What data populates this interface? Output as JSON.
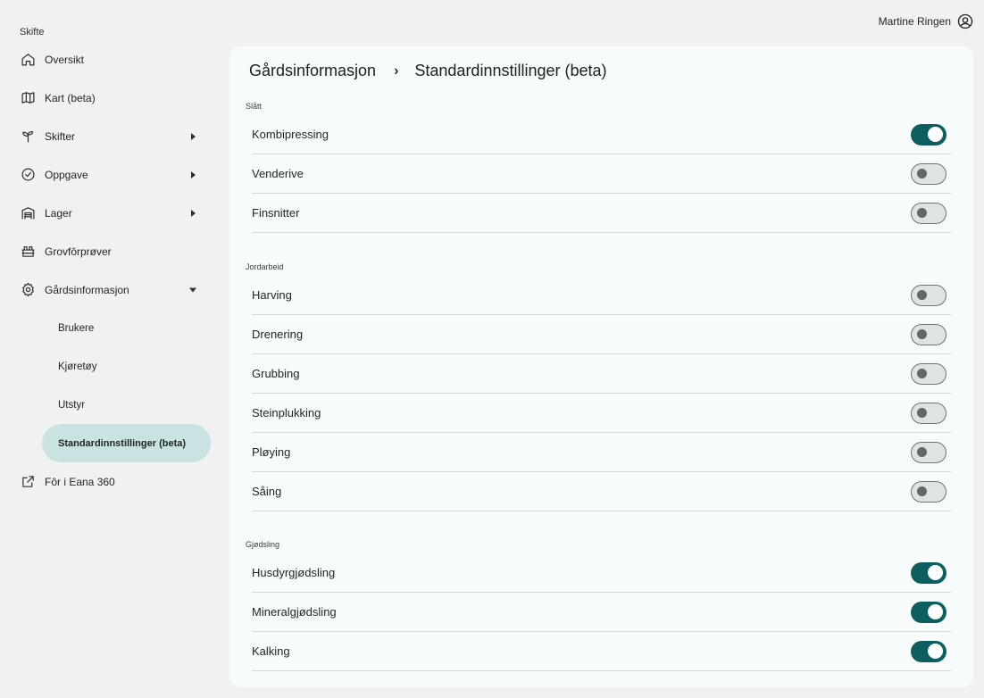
{
  "app": {
    "brand": "Skifte"
  },
  "user": {
    "name": "Martine Ringen",
    "icon": "account-circle-icon"
  },
  "sidebar": {
    "items": [
      {
        "label": "Oversikt",
        "icon": "home-icon"
      },
      {
        "label": "Kart (beta)",
        "icon": "map-icon"
      },
      {
        "label": "Skifter",
        "icon": "sprout-icon",
        "expandable": true
      },
      {
        "label": "Oppgave",
        "icon": "check-circle-icon",
        "expandable": true
      },
      {
        "label": "Lager",
        "icon": "warehouse-icon",
        "expandable": true
      },
      {
        "label": "Grovfôrprøver",
        "icon": "sample-icon"
      },
      {
        "label": "Gårdsinformasjon",
        "icon": "gear-icon",
        "expanded": true
      }
    ],
    "subitems": [
      {
        "label": "Brukere"
      },
      {
        "label": "Kjøretøy"
      },
      {
        "label": "Utstyr"
      },
      {
        "label": "Standardinnstillinger (beta)",
        "active": true
      }
    ],
    "external": {
      "label": "Fôr i Eana 360",
      "icon": "external-link-icon"
    }
  },
  "breadcrumb": {
    "parent": "Gårdsinformasjon",
    "separator": "›",
    "current": "Standardinnstillinger (beta)"
  },
  "sections": [
    {
      "title": "Slått",
      "rows": [
        {
          "label": "Kombipressing",
          "enabled": true
        },
        {
          "label": "Venderive",
          "enabled": false
        },
        {
          "label": "Finsnitter",
          "enabled": false
        }
      ]
    },
    {
      "title": "Jordarbeid",
      "rows": [
        {
          "label": "Harving",
          "enabled": false
        },
        {
          "label": "Drenering",
          "enabled": false
        },
        {
          "label": "Grubbing",
          "enabled": false
        },
        {
          "label": "Steinplukking",
          "enabled": false
        },
        {
          "label": "Pløying",
          "enabled": false
        },
        {
          "label": "Såing",
          "enabled": false
        }
      ]
    },
    {
      "title": "Gjødsling",
      "rows": [
        {
          "label": "Husdyrgjødsling",
          "enabled": true
        },
        {
          "label": "Mineralgjødsling",
          "enabled": true
        },
        {
          "label": "Kalking",
          "enabled": true
        }
      ]
    }
  ],
  "colors": {
    "accent": "#0d5f5f",
    "active_nav_bg": "#c9e3e3",
    "background": "#f0f1f1",
    "card": "#f7fbfb"
  }
}
